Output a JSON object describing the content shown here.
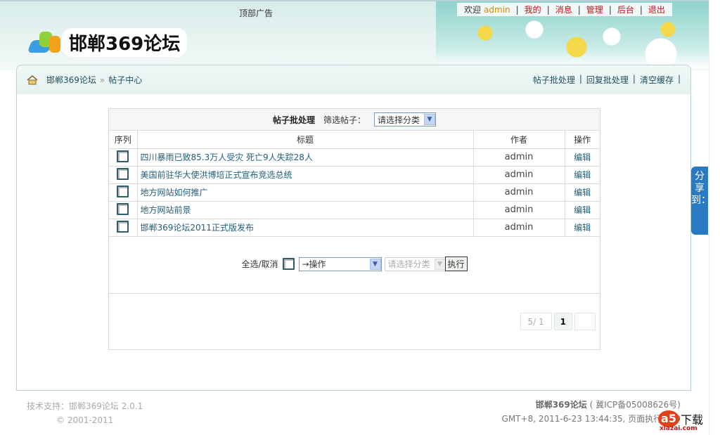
{
  "header": {
    "top_ad": "顶部广告",
    "logo_text": "邯郸369论坛",
    "usernav": {
      "welcome": "欢迎",
      "username": "admin",
      "links": [
        "我的",
        "消息",
        "管理",
        "后台",
        "退出"
      ]
    }
  },
  "breadcrumb": {
    "home": "邯郸369论坛",
    "sep": "»",
    "current": "帖子中心"
  },
  "toplinks": [
    "帖子批处理",
    "回复批处理",
    "清空缓存"
  ],
  "batch_box": {
    "title": "帖子批处理",
    "filter_label": "筛选帖子：",
    "filter_value": "请选择分类",
    "columns": [
      "序列",
      "标题",
      "作者",
      "操作"
    ],
    "rows": [
      {
        "title": "四川暴雨已致85.3万人受灾 死亡9人失踪28人",
        "author": "admin",
        "action": "编辑"
      },
      {
        "title": "美国前驻华大使洪博培正式宣布竞选总统",
        "author": "admin",
        "action": "编辑"
      },
      {
        "title": "地方网站如何推广",
        "author": "admin",
        "action": "编辑"
      },
      {
        "title": "地方网站前景",
        "author": "admin",
        "action": "编辑"
      },
      {
        "title": "邯郸369论坛2011正式版发布",
        "author": "admin",
        "action": "编辑"
      }
    ],
    "select_all": "全选/取消",
    "operation_value": "→操作",
    "category_value": "请选择分类",
    "execute": "执行"
  },
  "pager": {
    "info": "5/ 1",
    "current": "1"
  },
  "footer": {
    "tech": "技术支持：邯郸369论坛 2.0.1",
    "copyright": "© 2001-2011",
    "site": "邯郸369论坛",
    "icp": "( 冀ICP备05008626号)",
    "time": "GMT+8, 2011-6-23 13:44:35, 页面执行.000"
  },
  "share": "分享到：",
  "watermark": {
    "logo": "a5",
    "text": "下载",
    "url": "xiazai.com"
  }
}
